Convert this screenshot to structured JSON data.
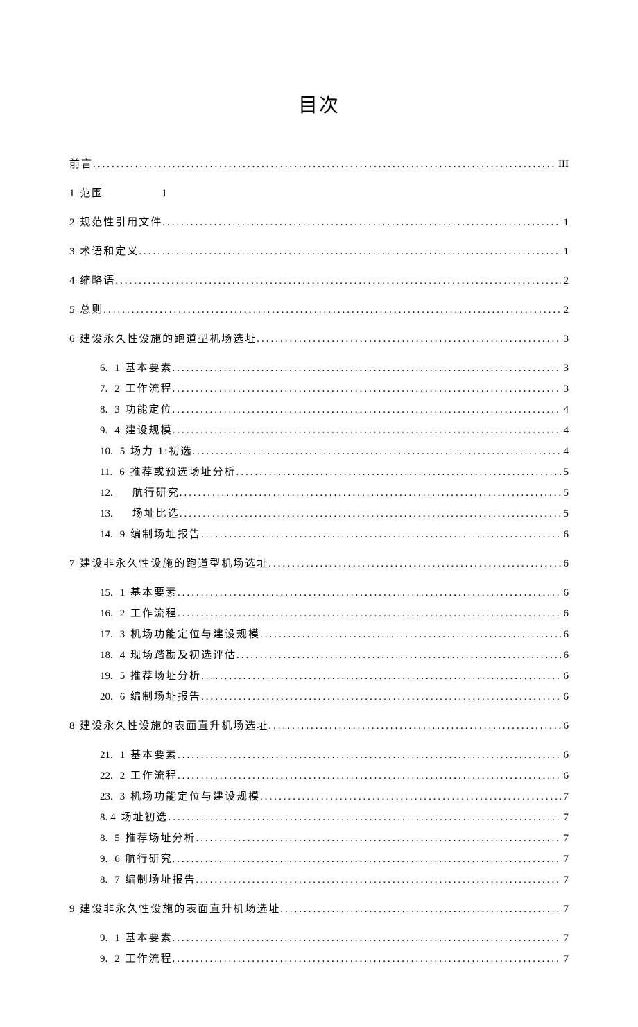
{
  "title": "目次",
  "preface": {
    "label": "前言",
    "page": "III"
  },
  "sections": [
    {
      "label": "1  范围",
      "page": "1",
      "noLeader": true,
      "sub": []
    },
    {
      "label": "2 规范性引用文件",
      "page": "1",
      "sub": []
    },
    {
      "label": "3 术语和定义",
      "page": "1",
      "sub": []
    },
    {
      "label": "4 缩略语",
      "page": "2",
      "sub": []
    },
    {
      "label": "5 总则",
      "page": "2",
      "sub": []
    },
    {
      "label": "6 建设永久性设施的跑道型机场选址",
      "page": "3",
      "sub": [
        {
          "num": "6.",
          "label": "1 基本要素",
          "page": "3"
        },
        {
          "num": "7.",
          "label": "2 工作流程",
          "page": "3"
        },
        {
          "num": "8.",
          "label": "3 功能定位",
          "page": "4"
        },
        {
          "num": "9.",
          "label": "4 建设规模",
          "page": "4"
        },
        {
          "num": "10.",
          "label": "5 场力 1:初选",
          "page": "4"
        },
        {
          "num": "11.",
          "label": "6 推荐或预选场址分析",
          "page": "5"
        },
        {
          "num": "12.",
          "label": "航行研究",
          "page": "5",
          "wide": true
        },
        {
          "num": "13.",
          "label": "场址比选",
          "page": "5",
          "wide": true
        },
        {
          "num": "14.",
          "label": "9 编制场址报告",
          "page": "6"
        }
      ]
    },
    {
      "label": "7 建设非永久性设施的跑道型机场选址",
      "page": "6",
      "sub": [
        {
          "num": "15.",
          "label": "1 基本要素",
          "page": "6"
        },
        {
          "num": "16.",
          "label": "2 工作流程",
          "page": "6"
        },
        {
          "num": "17.",
          "label": "3 机场功能定位与建设规模",
          "page": "6"
        },
        {
          "num": "18.",
          "label": "4 现场踏勘及初选评估",
          "page": "6"
        },
        {
          "num": "19.",
          "label": "5 推荐场址分析",
          "page": "6"
        },
        {
          "num": "20.",
          "label": "6 编制场址报告",
          "page": "6"
        }
      ]
    },
    {
      "label": "8 建设永久性设施的表面直升机场选址",
      "page": "6",
      "sub": [
        {
          "num": "21.",
          "label": "1 基本要素",
          "page": "6"
        },
        {
          "num": "22.",
          "label": "2 工作流程",
          "page": "6"
        },
        {
          "num": "23.",
          "label": "3 机场功能定位与建设规模",
          "page": "7"
        },
        {
          "num": "8.",
          "label": "4 场址初选",
          "page": "7",
          "tight": true
        },
        {
          "num": "8.",
          "label": "5 推荐场址分析",
          "page": "7"
        },
        {
          "num": "9.",
          "label": "6 航行研究",
          "page": "7"
        },
        {
          "num": "8.",
          "label": "7 编制场址报告",
          "page": "7"
        }
      ]
    },
    {
      "label": "9 建设非永久性设施的表面直升机场选址",
      "page": "7",
      "sub": [
        {
          "num": "9.",
          "label": "1 基本要素",
          "page": "7"
        },
        {
          "num": "9.",
          "label": "2 工作流程",
          "page": "7"
        }
      ]
    }
  ]
}
